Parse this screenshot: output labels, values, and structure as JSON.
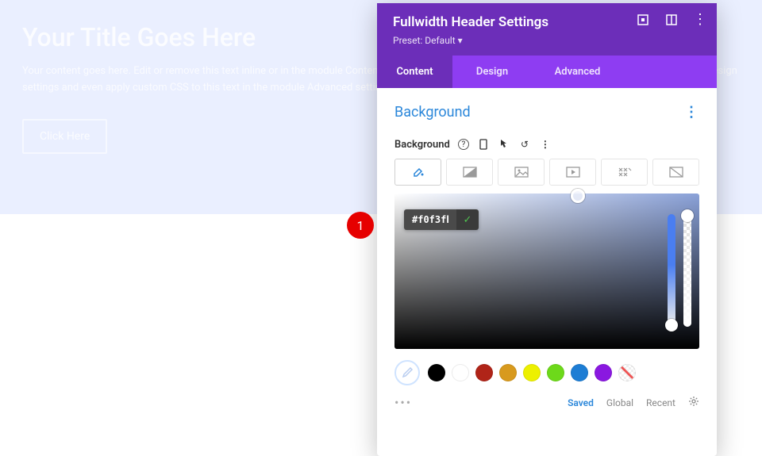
{
  "hero": {
    "title": "Your Title Goes Here",
    "body": "Your content goes here. Edit or remove this text inline or in the module Content settings. You can also style every aspect of this content in the module Design settings and even apply custom CSS to this text in the module Advanced settings.",
    "button": "Click Here"
  },
  "panel": {
    "title": "Fullwidth Header Settings",
    "preset": "Preset: Default ▾",
    "tabs": [
      "Content",
      "Design",
      "Advanced"
    ],
    "section": "Background",
    "label": "Background",
    "hex": "#f0f3fb",
    "presets": {
      "saved": "Saved",
      "global": "Global",
      "recent": "Recent"
    }
  },
  "swatches": [
    "#000000",
    "#ffffff",
    "#b02418",
    "#d89a1e",
    "#edf000",
    "#6dd91a",
    "#1d7dd4",
    "#8a18e0"
  ],
  "annotation": {
    "num": "1"
  }
}
